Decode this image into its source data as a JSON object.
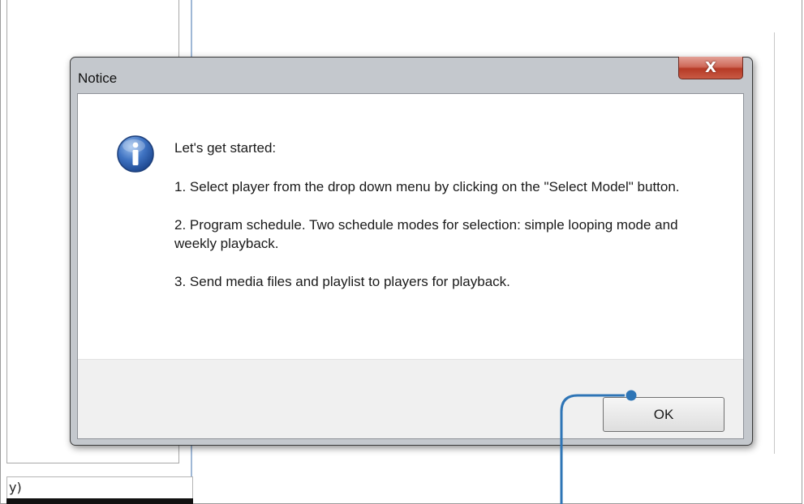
{
  "background": {
    "status_text": "y)"
  },
  "dialog": {
    "title": "Notice",
    "close_glyph": "X",
    "icon": "information-icon",
    "message": {
      "intro": "Let's get started:",
      "steps": [
        "1. Select player from the drop down menu by clicking on the \"Select Model\" button.",
        "2. Program schedule. Two schedule modes for selection: simple looping mode and weekly playback.",
        "3. Send media files and playlist to players for playback."
      ]
    },
    "ok_label": "OK"
  },
  "colors": {
    "callout": "#2e75b6",
    "close_button": "#c85a44",
    "info_icon": "#2f5fa8"
  }
}
